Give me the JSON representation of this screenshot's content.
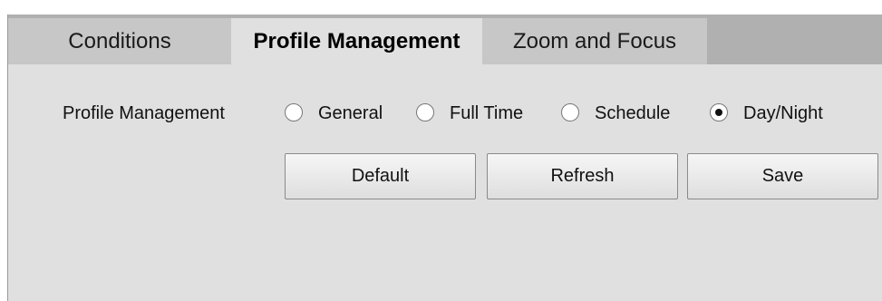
{
  "tabs": {
    "conditions": "Conditions",
    "profile_management": "Profile Management",
    "zoom_and_focus": "Zoom and Focus",
    "active": "Profile Management"
  },
  "profile_management": {
    "label": "Profile Management",
    "options": [
      {
        "label": "General",
        "selected": false
      },
      {
        "label": "Full Time",
        "selected": false
      },
      {
        "label": "Schedule",
        "selected": false
      },
      {
        "label": "Day/Night",
        "selected": true
      }
    ]
  },
  "buttons": {
    "default": "Default",
    "refresh": "Refresh",
    "save": "Save"
  },
  "colors": {
    "tabbar": "#b0b0b0",
    "inactive_tab": "#c7c7c7",
    "panel": "#e0e0e0"
  }
}
